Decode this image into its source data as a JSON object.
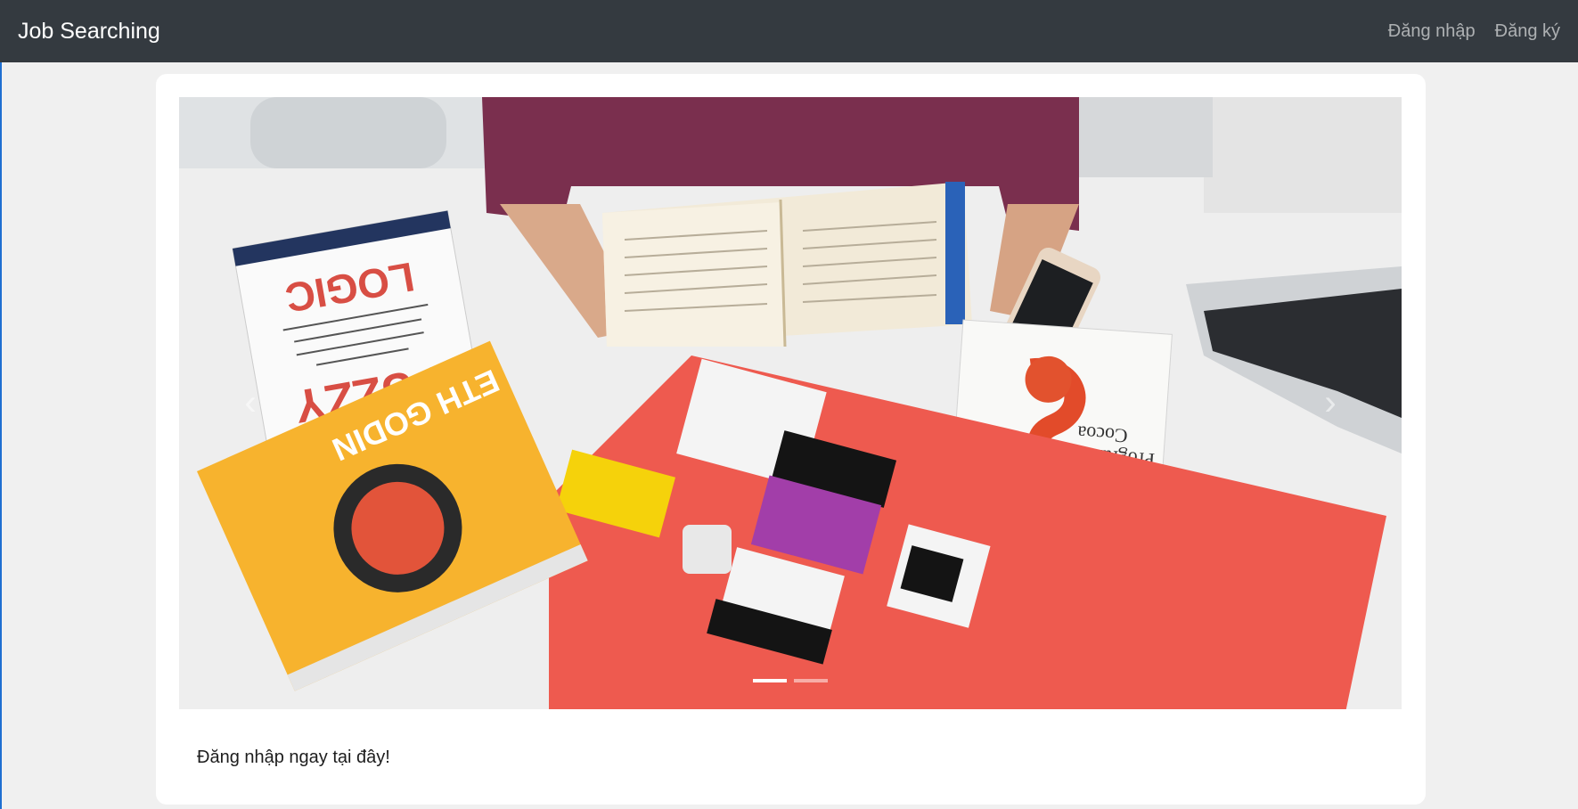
{
  "navbar": {
    "brand": "Job Searching",
    "login": "Đăng nhập",
    "register": "Đăng ký"
  },
  "carousel": {
    "slides": 2,
    "active_index": 0,
    "book_titles": {
      "fuzzy": "FUZZY",
      "logic": "LOGIC",
      "cocoa_1": "Cocoa",
      "cocoa_2": "Programming",
      "godin": "ETH GODIN"
    }
  },
  "main": {
    "cta_text": "Đăng nhập ngay tại đây!"
  }
}
